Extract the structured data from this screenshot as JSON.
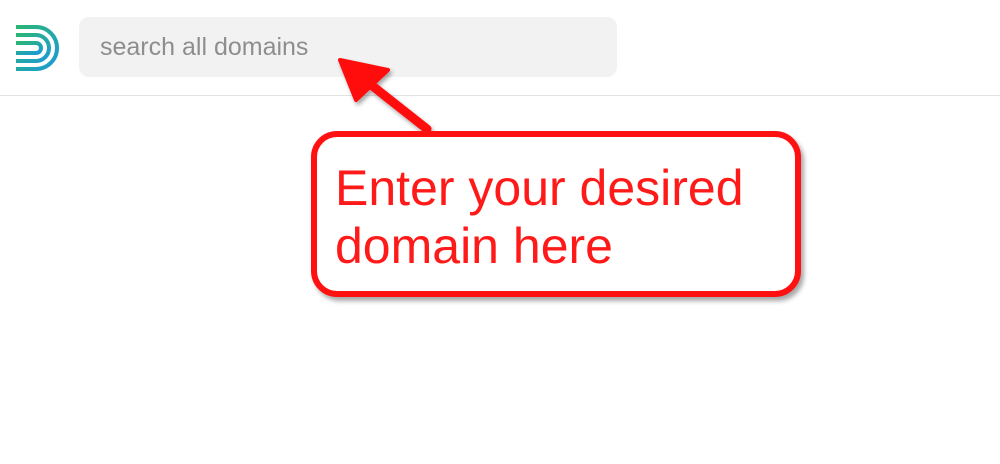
{
  "header": {
    "logo_icon": "d-stripes-logo-icon",
    "brand_colors": [
      "#1b9bd7",
      "#2bb673"
    ]
  },
  "search": {
    "placeholder": "search all domains",
    "value": ""
  },
  "annotation": {
    "text": "Enter your desired domain here",
    "color": "#ff1111",
    "icon": "arrow-icon"
  }
}
